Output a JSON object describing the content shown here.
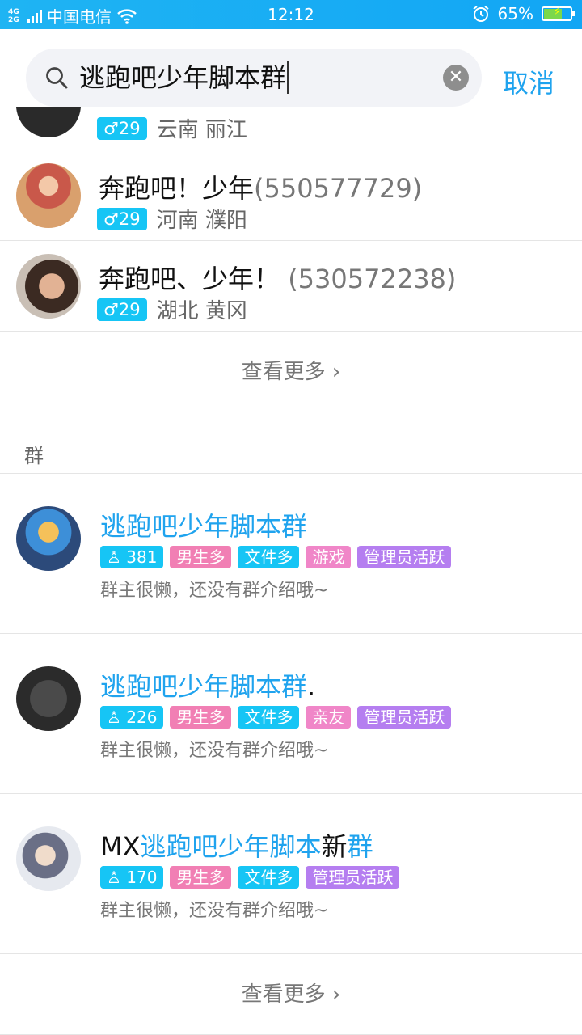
{
  "status_bar": {
    "network_top": "4G",
    "network_bottom": "2G",
    "carrier": "中国电信",
    "time": "12:12",
    "battery": "65%"
  },
  "search": {
    "query": "逃跑吧少年脚本群",
    "cancel_label": "取消"
  },
  "people": [
    {
      "name": "奔跑吧！少年",
      "qq": "(550577729)",
      "gender_icon": "♂",
      "age": "29",
      "location": "河南 濮阳"
    },
    {
      "name": "奔跑吧、少年！",
      "qq": "(530572238)",
      "gender_icon": "♂",
      "age": "29",
      "location": "湖北 黄冈"
    }
  ],
  "partial_row": {
    "age": "29",
    "location": "云南 丽江"
  },
  "see_more_label": "查看更多",
  "groups_section_label": "群",
  "groups": [
    {
      "name_plain": "",
      "name_highlight": "逃跑吧少年脚本群",
      "name_suffix": "",
      "members": "381",
      "tags": [
        "男生多",
        "文件多",
        "游戏",
        "管理员活跃"
      ],
      "description": "群主很懒，还没有群介绍哦~"
    },
    {
      "name_plain": "",
      "name_highlight": "逃跑吧少年脚本群",
      "name_suffix": ".",
      "members": "226",
      "tags": [
        "男生多",
        "文件多",
        "亲友",
        "管理员活跃"
      ],
      "description": "群主很懒，还没有群介绍哦~"
    },
    {
      "name_plain": "MX",
      "name_highlight": "逃跑吧少年脚本",
      "name_mid": "新",
      "name_highlight2": "群",
      "members": "170",
      "tags": [
        "男生多",
        "文件多",
        "管理员活跃"
      ],
      "description": "群主很懒，还没有群介绍哦~"
    }
  ],
  "colors": {
    "status_bar": "#12a6f4",
    "accent": "#1fa3ee",
    "tag_blue": "#16c5f5",
    "tag_pink": "#f17fb4",
    "tag_purple": "#b57ef0"
  }
}
